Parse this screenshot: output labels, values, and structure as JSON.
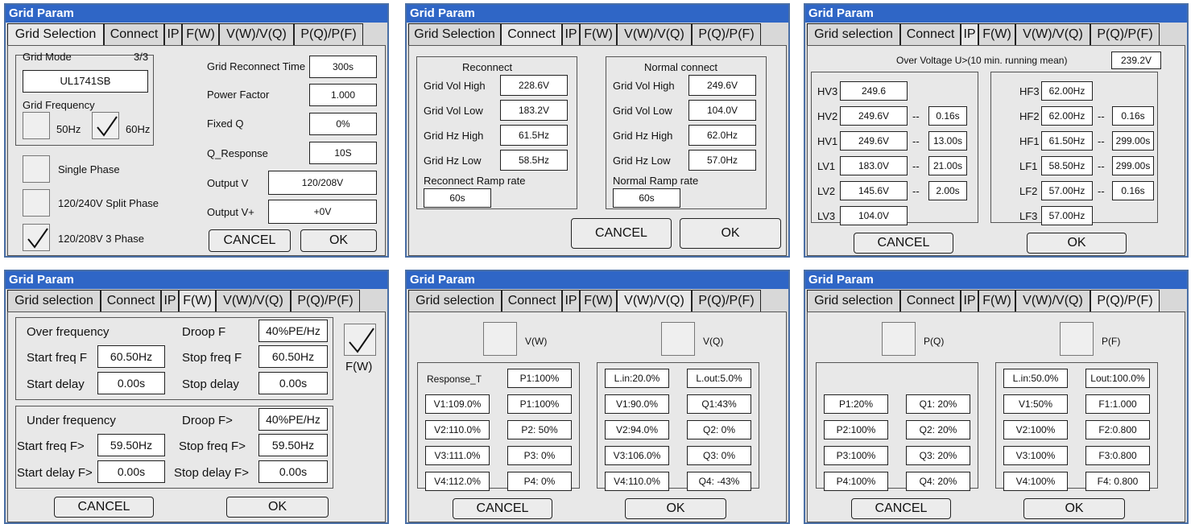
{
  "title": "Grid Param",
  "p1": {
    "tabs": [
      "Grid Selection",
      "Connect",
      "IP",
      "F(W)",
      "V(W)/V(Q)",
      "P(Q)/P(F)"
    ],
    "grid_mode_label": "Grid Mode",
    "grid_mode_page": "3/3",
    "grid_mode_value": "UL1741SB",
    "grid_freq_label": "Grid Frequency",
    "hz50": "50Hz",
    "hz60": "60Hz",
    "single_phase": "Single Phase",
    "split_phase": "120/240V Split Phase",
    "three_phase": "120/208V 3 Phase",
    "reconnect_time_label": "Grid Reconnect Time",
    "reconnect_time": "300s",
    "pf_label": "Power Factor",
    "pf": "1.000",
    "fixedq_label": "Fixed Q",
    "fixedq": "0%",
    "qresp_label": "Q_Response",
    "qresp": "10S",
    "outv_label": "Output V",
    "outv": "120/208V",
    "outvp_label": "Output V+",
    "outvp": "+0V",
    "cancel": "CANCEL",
    "ok": "OK"
  },
  "p2": {
    "tabs": [
      "Grid Selection",
      "Connect",
      "IP",
      "F(W)",
      "V(W)/V(Q)",
      "P(Q)/P(F)"
    ],
    "rec_title": "Reconnect",
    "norm_title": "Normal connect",
    "labels": [
      "Grid Vol High",
      "Grid Vol Low",
      "Grid Hz High",
      "Grid Hz Low"
    ],
    "rec_vals": [
      "228.6V",
      "183.2V",
      "61.5Hz",
      "58.5Hz"
    ],
    "norm_vals": [
      "249.6V",
      "104.0V",
      "62.0Hz",
      "57.0Hz"
    ],
    "rec_ramp_label": "Reconnect Ramp rate",
    "rec_ramp": "60s",
    "norm_ramp_label": "Normal Ramp rate",
    "norm_ramp": "60s",
    "cancel": "CANCEL",
    "ok": "OK"
  },
  "p3": {
    "tabs": [
      "Grid selection",
      "Connect",
      "IP",
      "F(W)",
      "V(W)/V(Q)",
      "P(Q)/P(F)"
    ],
    "ov_label": "Over Voltage U>(10 min. running mean)",
    "ov": "239.2V",
    "v_labels": [
      "HV3",
      "HV2",
      "HV1",
      "LV1",
      "LV2",
      "LV3"
    ],
    "v_vals": [
      "249.6",
      "249.6V",
      "249.6V",
      "183.0V",
      "145.6V",
      "104.0V"
    ],
    "v_times": [
      "",
      "0.16s",
      "13.00s",
      "21.00s",
      "2.00s",
      ""
    ],
    "f_labels": [
      "HF3",
      "HF2",
      "HF1",
      "LF1",
      "LF2",
      "LF3"
    ],
    "f_vals": [
      "62.00Hz",
      "62.00Hz",
      "61.50Hz",
      "58.50Hz",
      "57.00Hz",
      "57.00Hz"
    ],
    "f_times": [
      "",
      "0.16s",
      "299.00s",
      "299.00s",
      "0.16s",
      ""
    ],
    "sep": "--",
    "cancel": "CANCEL",
    "ok": "OK"
  },
  "p4": {
    "tabs": [
      "Grid selection",
      "Connect",
      "IP",
      "F(W)",
      "V(W)/V(Q)",
      "P(Q)/P(F)"
    ],
    "over_label": "Over frequency",
    "droop_label": "Droop F",
    "droop": "40%PE/Hz",
    "start_label": "Start freq F",
    "start": "60.50Hz",
    "stop_label": "Stop freq F",
    "stop": "60.50Hz",
    "sdelay_label": "Start delay",
    "sdelay": "0.00s",
    "pdelay_label": "Stop delay",
    "pdelay": "0.00s",
    "under_label": "Under frequency",
    "udroop_label": "Droop F>",
    "udroop": "40%PE/Hz",
    "ustart_label": "Start freq F>",
    "ustart": "59.50Hz",
    "ustop_label": "Stop freq F>",
    "ustop": "59.50Hz",
    "usdelay_label": "Start delay F>",
    "usdelay": "0.00s",
    "updelay_label": "Stop delay F>",
    "updelay": "0.00s",
    "fw": "F(W)",
    "cancel": "CANCEL",
    "ok": "OK"
  },
  "p5": {
    "tabs": [
      "Grid selection",
      "Connect",
      "IP",
      "F(W)",
      "V(W)/V(Q)",
      "P(Q)/P(F)"
    ],
    "vw": "V(W)",
    "vq": "V(Q)",
    "left": [
      [
        "Response_T",
        "P1:100%"
      ],
      [
        "V1:109.0%",
        "P1:100%"
      ],
      [
        "V2:110.0%",
        "P2: 50%"
      ],
      [
        "V3:111.0%",
        "P3: 0%"
      ],
      [
        "V4:112.0%",
        "P4: 0%"
      ]
    ],
    "right": [
      [
        "L.in:20.0%",
        "L.out:5.0%"
      ],
      [
        "V1:90.0%",
        "Q1:43%"
      ],
      [
        "V2:94.0%",
        "Q2: 0%"
      ],
      [
        "V3:106.0%",
        "Q3: 0%"
      ],
      [
        "V4:110.0%",
        "Q4: -43%"
      ]
    ],
    "cancel": "CANCEL",
    "ok": "OK"
  },
  "p6": {
    "tabs": [
      "Grid selection",
      "Connect",
      "IP",
      "F(W)",
      "V(W)/V(Q)",
      "P(Q)/P(F)"
    ],
    "pq": "P(Q)",
    "pf": "P(F)",
    "left": [
      [
        "P1:20%",
        "Q1: 20%"
      ],
      [
        "P2:100%",
        "Q2: 20%"
      ],
      [
        "P3:100%",
        "Q3: 20%"
      ],
      [
        "P4:100%",
        "Q4: 20%"
      ]
    ],
    "right": [
      [
        "L.in:50.0%",
        "Lout:100.0%"
      ],
      [
        "V1:50%",
        "F1:1.000"
      ],
      [
        "V2:100%",
        "F2:0.800"
      ],
      [
        "V3:100%",
        "F3:0.800"
      ],
      [
        "V4:100%",
        "F4: 0.800"
      ]
    ],
    "cancel": "CANCEL",
    "ok": "OK"
  }
}
